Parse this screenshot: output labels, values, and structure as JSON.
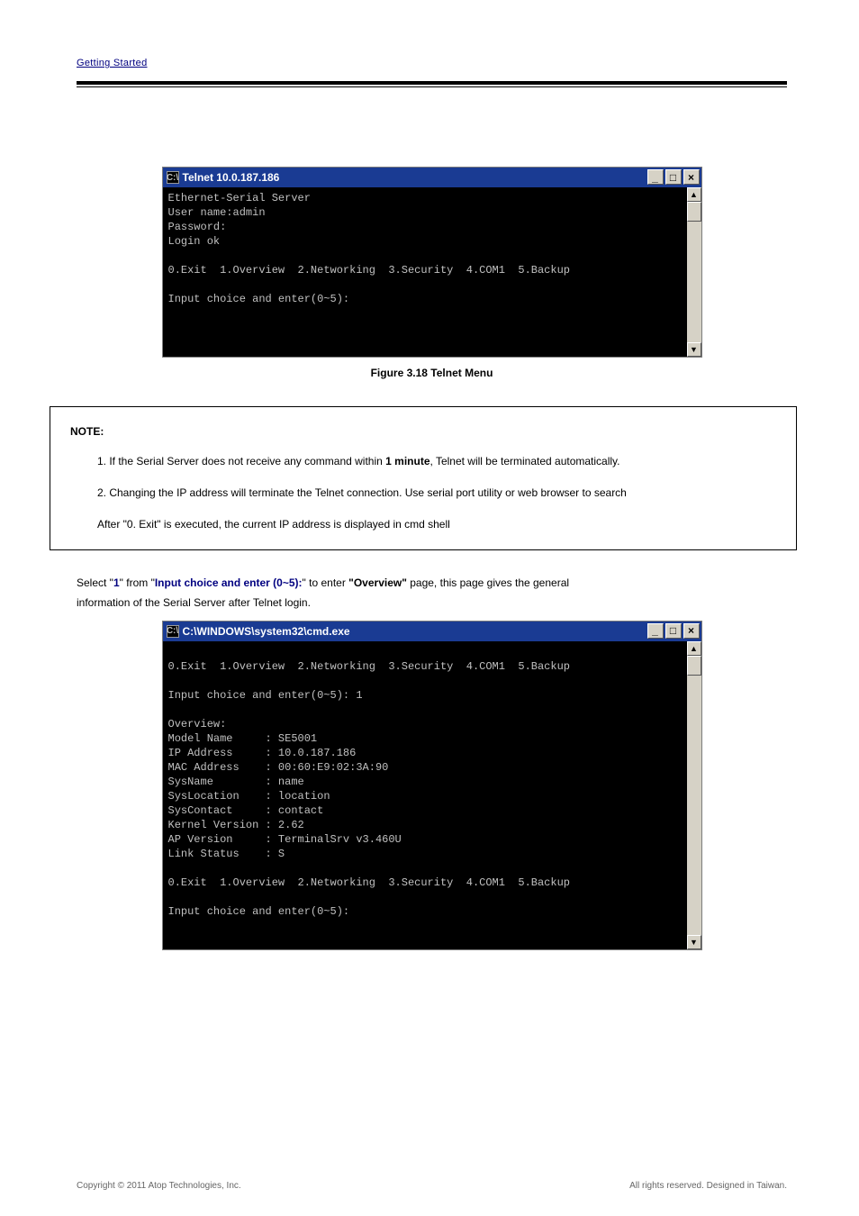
{
  "header": {
    "breadcrumb": "Getting Started"
  },
  "cmd1": {
    "title_prefix": "C:\\",
    "title": "Telnet 10.0.187.186",
    "btn_min": "_",
    "btn_max": "□",
    "btn_close": "×",
    "body": "Ethernet-Serial Server\nUser name:admin\nPassword:\nLogin ok\n\n0.Exit  1.Overview  2.Networking  3.Security  4.COM1  5.Backup\n\nInput choice and enter(0~5):\n\n"
  },
  "fig1_caption": "Figure 3.18 Telnet Menu",
  "note": {
    "title": "NOTE:",
    "line1_a": "1. If the Serial Server does not receive any command within ",
    "line1_b": "1 minute",
    "line1_c": ", Telnet will be terminated automatically.",
    "line2_a": "2. Changing the IP address will terminate the Telnet connection. Use serial port utility or web browser to search",
    "line2_b": "After \"0. Exit\" is ",
    "line2_c": "executed, the current IP address is displayed in cmd shell"
  },
  "para": {
    "t1": "Select \"",
    "bold1": "1",
    "t2": "\" from \"",
    "bold2": "Input choice and enter (0~5):",
    "t3": "\" to enter ",
    "bold3": "\"Overview\"",
    "t4": " page, this page gives the general"
  },
  "cmd2": {
    "title_prefix": "C:\\",
    "title": "C:\\WINDOWS\\system32\\cmd.exe",
    "btn_min": "_",
    "btn_max": "□",
    "btn_close": "×",
    "body": "\n0.Exit  1.Overview  2.Networking  3.Security  4.COM1  5.Backup\n\nInput choice and enter(0~5): 1\n\nOverview:\nModel Name     : SE5001\nIP Address     : 10.0.187.186\nMAC Address    : 00:60:E9:02:3A:90\nSysName        : name\nSysLocation    : location\nSysContact     : contact\nKernel Version : 2.62\nAP Version     : TerminalSrv v3.460U\nLink Status    : S\n\n0.Exit  1.Overview  2.Networking  3.Security  4.COM1  5.Backup\n\nInput choice and enter(0~5):"
  },
  "chart_data": {
    "type": "table",
    "title": "Overview",
    "rows": [
      {
        "label": "Model Name",
        "value": "SE5001"
      },
      {
        "label": "IP Address",
        "value": "10.0.187.186"
      },
      {
        "label": "MAC Address",
        "value": "00:60:E9:02:3A:90"
      },
      {
        "label": "SysName",
        "value": "name"
      },
      {
        "label": "SysLocation",
        "value": "location"
      },
      {
        "label": "SysContact",
        "value": "contact"
      },
      {
        "label": "Kernel Version",
        "value": "2.62"
      },
      {
        "label": "AP Version",
        "value": "TerminalSrv v3.460U"
      },
      {
        "label": "Link Status",
        "value": "S"
      }
    ],
    "menu": [
      "0.Exit",
      "1.Overview",
      "2.Networking",
      "3.Security",
      "4.COM1",
      "5.Backup"
    ],
    "prompt": "Input choice and enter(0~5):"
  },
  "footer": {
    "left": "Copyright © 2011 Atop Technologies, Inc.",
    "right_a": "All rights reserved. Designed in Taiwan.",
    "right_b": ""
  }
}
